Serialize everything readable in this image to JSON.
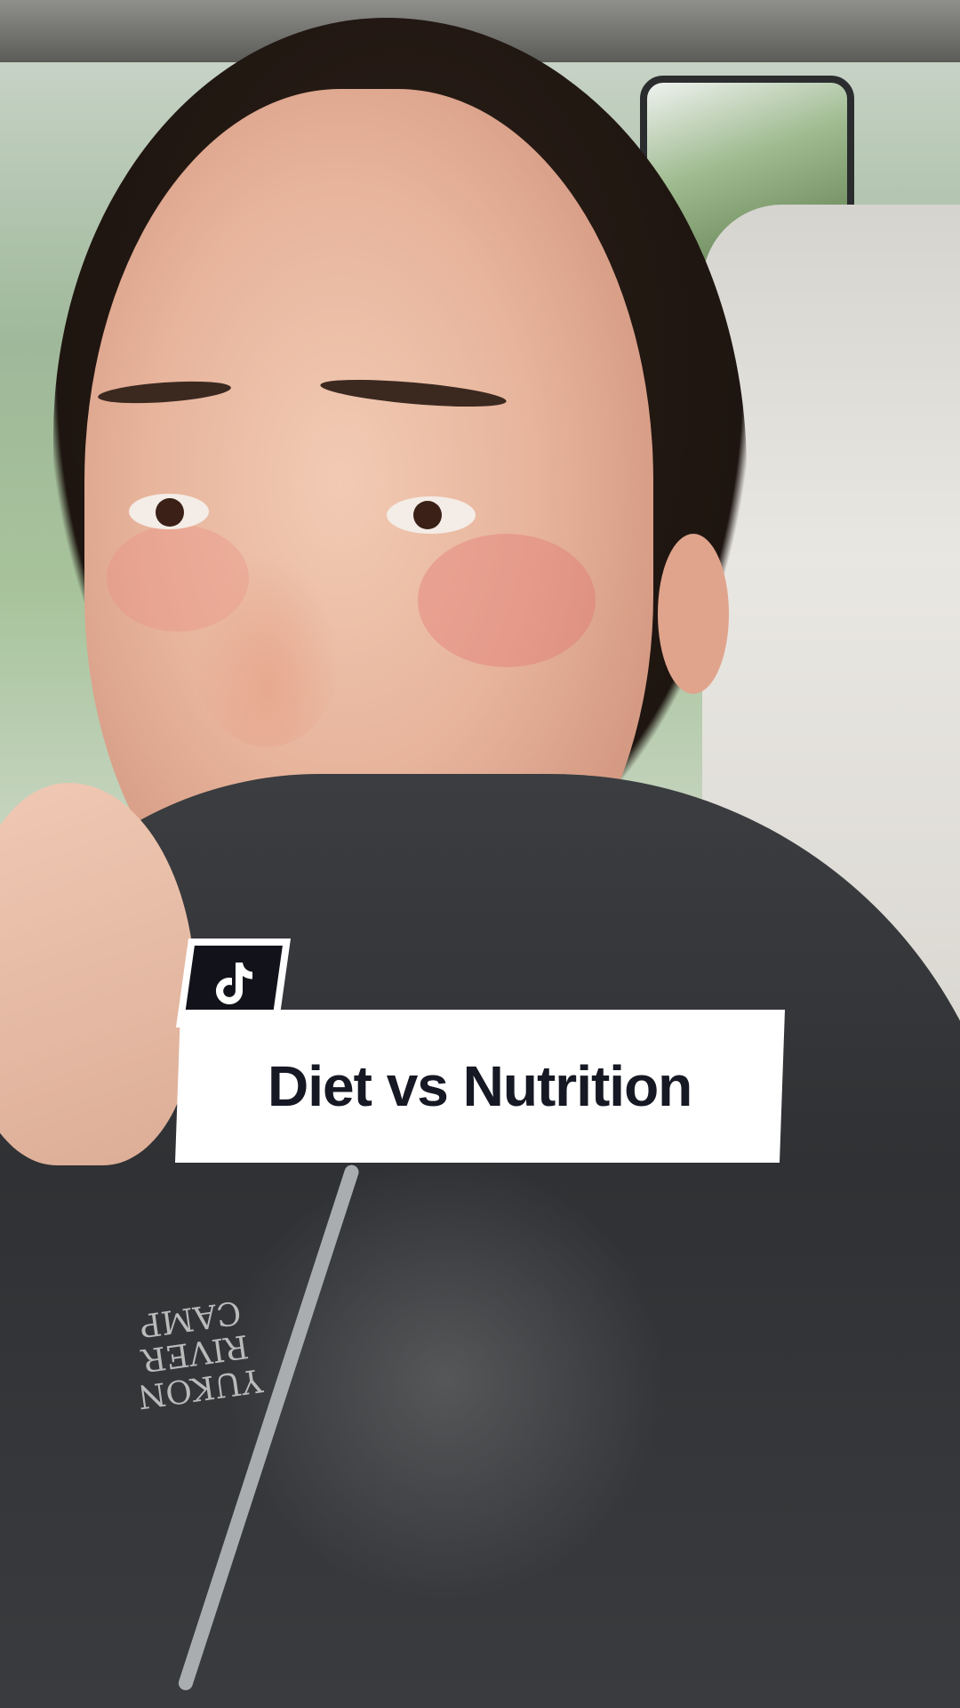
{
  "overlay": {
    "badge_icon": "tiktok-logo-icon",
    "title": "Diet vs Nutrition"
  },
  "scene": {
    "hoodie_print_line1": "YUKON RIVER",
    "hoodie_print_line2": "CAMP"
  },
  "colors": {
    "card_background": "#ffffff",
    "title_text": "#161823",
    "badge_background": "#12131a"
  }
}
